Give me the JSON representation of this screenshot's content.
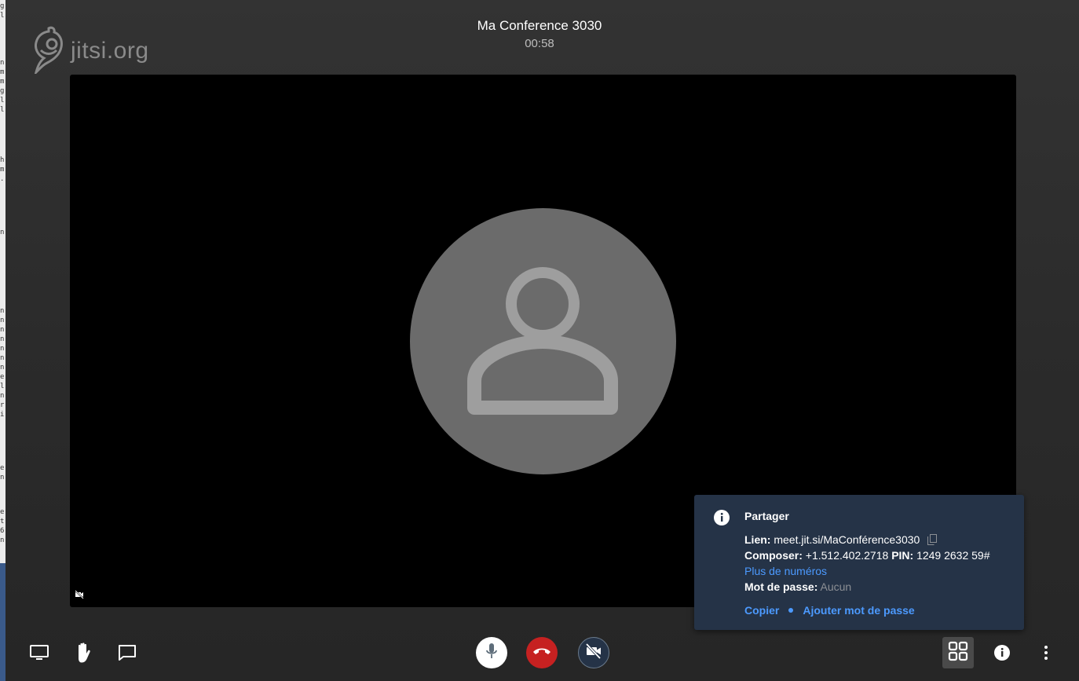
{
  "logo": {
    "text": "jitsi.org",
    "icon": "jitsi-logo-icon"
  },
  "header": {
    "title": "Ma Conference 3030",
    "timer": "00:58"
  },
  "video": {
    "participant_avatar": "user-avatar-icon",
    "camera_status_icon": "video-off-icon"
  },
  "share_popup": {
    "title": "Partager",
    "link_label": "Lien:",
    "link_value": "meet.jit.si/MaConférence3030",
    "dial_label": "Composer:",
    "dial_value": "+1.512.402.2718",
    "pin_label": "PIN:",
    "pin_value": "1249 2632 59#",
    "more_numbers": "Plus de numéros",
    "password_label": "Mot de passe:",
    "password_value": "Aucun",
    "copy_action": "Copier",
    "add_password_action": "Ajouter mot de passe"
  },
  "toolbar": {
    "left": [
      "screen-share-icon",
      "raise-hand-icon",
      "chat-icon"
    ],
    "center": [
      "microphone-icon",
      "hangup-icon",
      "camera-off-icon"
    ],
    "right": [
      "tile-view-icon",
      "info-icon",
      "more-options-icon"
    ]
  },
  "colors": {
    "hangup": "#c62121",
    "link": "#4c9aff",
    "popup_bg": "#253347",
    "avatar_bg": "#6b6b6b"
  }
}
